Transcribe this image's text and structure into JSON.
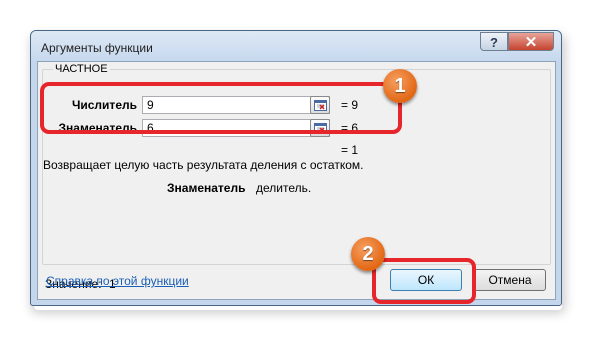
{
  "window": {
    "title": "Аргументы функции",
    "help_label": "?",
    "close_label": "✕"
  },
  "function": {
    "name": "ЧАСТНОЕ",
    "args": [
      {
        "label": "Числитель",
        "value": "9",
        "result": "=  9"
      },
      {
        "label": "Знаменатель",
        "value": "6",
        "result": "=  6"
      }
    ],
    "overall_result": "=  1",
    "description": "Возвращает целую часть результата деления с остатком.",
    "arg_help_name": "Знаменатель",
    "arg_help_text": "делитель."
  },
  "footer": {
    "value_label": "Значение:",
    "value": "1",
    "help_link": "Справка по этой функции",
    "ok_label": "ОК",
    "cancel_label": "Отмена"
  },
  "annotations": {
    "badge1": "1",
    "badge2": "2",
    "highlight_color": "#e6262b",
    "badge_color": "#e26714"
  },
  "icons": {
    "ref_button_icon": "collapse-dialog-icon"
  }
}
